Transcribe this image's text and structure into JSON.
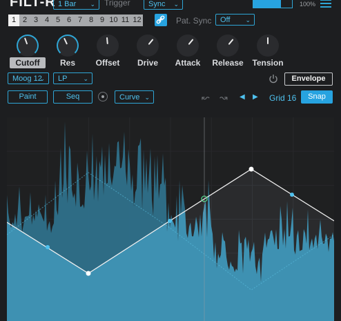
{
  "header": {
    "brand": "FILT-R",
    "length_value": "1 Bar",
    "trigger_label": "Trigger",
    "trigger_value": "Sync",
    "zoom": "100%"
  },
  "pattern": {
    "steps": [
      "1",
      "2",
      "3",
      "4",
      "5",
      "6",
      "7",
      "8",
      "9",
      "10",
      "11",
      "12"
    ],
    "selected": "1",
    "pat_sync_label": "Pat. Sync",
    "pat_sync_value": "Off"
  },
  "knobs": [
    {
      "label": "Cutoff",
      "highlighted": true
    },
    {
      "label": "Res"
    },
    {
      "label": "Offset"
    },
    {
      "label": "Drive"
    },
    {
      "label": "Attack"
    },
    {
      "label": "Release"
    },
    {
      "label": "Tension"
    }
  ],
  "filter": {
    "model": "Moog 12",
    "type": "LP",
    "envelope_label": "Envelope"
  },
  "toolbar": {
    "paint_label": "Paint",
    "seq_label": "Seq",
    "curve_value": "Curve",
    "grid_label": "Grid 16",
    "snap_label": "Snap"
  },
  "colors": {
    "accent": "#2fa6d6",
    "accent_fill": "#27a3e0",
    "waveform": "#3f97b9",
    "background": "#1d1e20"
  }
}
